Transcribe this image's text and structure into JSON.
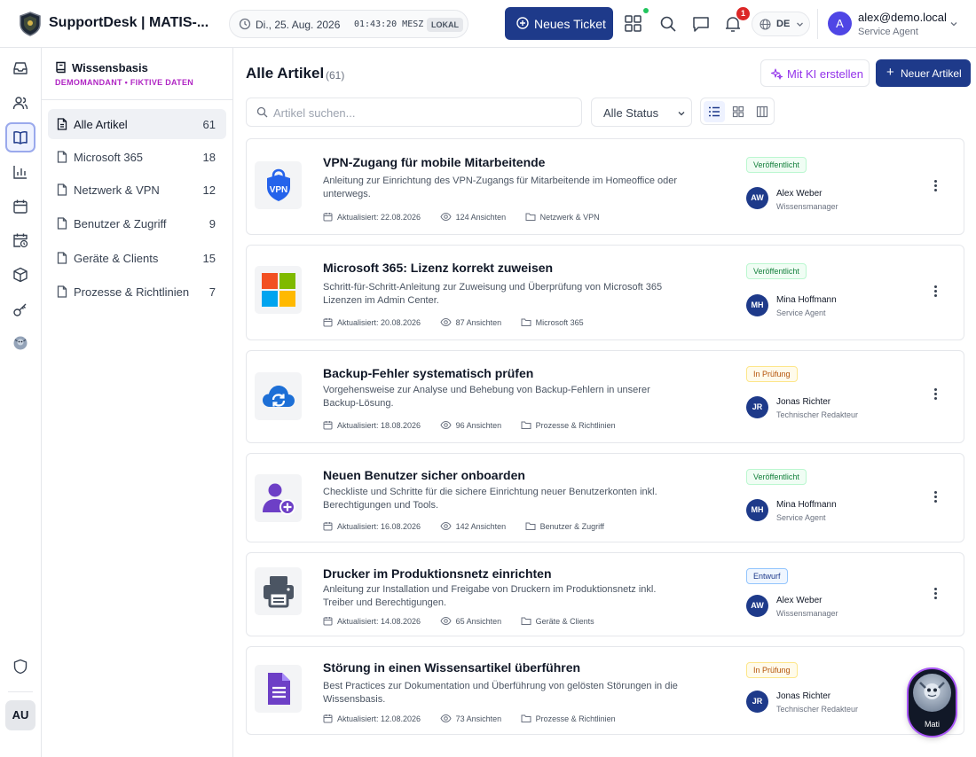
{
  "header": {
    "app_title": "SupportDesk | MATIS-...",
    "date": "Di., 25. Aug. 2026",
    "time": "01:43:20 MESZ",
    "time_badge": "LOKAL",
    "new_ticket_label": "Neues Ticket",
    "notification_count": "1",
    "language": "DE",
    "user_initial": "A",
    "user_email": "alex@demo.local",
    "user_role": "Service Agent"
  },
  "rail": {
    "user_initials": "AU"
  },
  "sidebar": {
    "title": "Wissensbasis",
    "subtitle": "DEMOMANDANT • FIKTIVE DATEN",
    "items": [
      {
        "label": "Alle Artikel",
        "count": "61",
        "active": true
      },
      {
        "label": "Microsoft 365",
        "count": "18"
      },
      {
        "label": "Netzwerk & VPN",
        "count": "12"
      },
      {
        "label": "Benutzer & Zugriff",
        "count": "9"
      },
      {
        "label": "Geräte & Clients",
        "count": "15"
      },
      {
        "label": "Prozesse & Richtlinien",
        "count": "7"
      }
    ]
  },
  "main": {
    "title": "Alle Artikel",
    "count": "(61)",
    "ai_button": "Mit KI erstellen",
    "new_article_button": "Neuer Artikel",
    "search_placeholder": "Artikel suchen...",
    "status_filter": "Alle Status"
  },
  "articles": [
    {
      "icon": "vpn-shield-icon",
      "title": "VPN-Zugang für mobile Mitarbeitende",
      "description": "Anleitung zur Einrichtung des VPN-Zugangs für Mitarbeitende im Homeoffice oder unterwegs.",
      "updated": "Aktualisiert: 22.08.2026",
      "views": "124 Ansichten",
      "category": "Netzwerk & VPN",
      "status": "Veröffentlicht",
      "author_initials": "AW",
      "author": "Alex Weber",
      "author_role": "Wissensmanager"
    },
    {
      "icon": "microsoft-logo-icon",
      "title": "Microsoft 365: Lizenz korrekt zuweisen",
      "description": "Schritt-für-Schritt-Anleitung zur Zuweisung und Überprüfung von Microsoft 365 Lizenzen im Admin Center.",
      "updated": "Aktualisiert: 20.08.2026",
      "views": "87 Ansichten",
      "category": "Microsoft 365",
      "status": "Veröffentlicht",
      "author_initials": "MH",
      "author": "Mina Hoffmann",
      "author_role": "Service Agent"
    },
    {
      "icon": "cloud-sync-icon",
      "title": "Backup-Fehler systematisch prüfen",
      "description": "Vorgehensweise zur Analyse und Behebung von Backup-Fehlern in unserer Backup-Lösung.",
      "updated": "Aktualisiert: 18.08.2026",
      "views": "96 Ansichten",
      "category": "Prozesse & Richtlinien",
      "status": "In Prüfung",
      "author_initials": "JR",
      "author": "Jonas Richter",
      "author_role": "Technischer Redakteur"
    },
    {
      "icon": "user-add-icon",
      "title": "Neuen Benutzer sicher onboarden",
      "description": "Checkliste und Schritte für die sichere Einrichtung neuer Benutzerkonten inkl. Berechtigungen und Tools.",
      "updated": "Aktualisiert: 16.08.2026",
      "views": "142 Ansichten",
      "category": "Benutzer & Zugriff",
      "status": "Veröffentlicht",
      "author_initials": "MH",
      "author": "Mina Hoffmann",
      "author_role": "Service Agent"
    },
    {
      "icon": "printer-icon",
      "title": "Drucker im Produktionsnetz einrichten",
      "description": "Anleitung zur Installation und Freigabe von Druckern im Produktionsnetz inkl. Treiber und Berechtigungen.",
      "updated": "Aktualisiert: 14.08.2026",
      "views": "65 Ansichten",
      "category": "Geräte & Clients",
      "status": "Entwurf",
      "author_initials": "AW",
      "author": "Alex Weber",
      "author_role": "Wissensmanager"
    },
    {
      "icon": "document-icon",
      "title": "Störung in einen Wissensartikel überführen",
      "description": "Best Practices zur Dokumentation und Überführung von gelösten Störungen in die Wissensbasis.",
      "updated": "Aktualisiert: 12.08.2026",
      "views": "73 Ansichten",
      "category": "Prozesse & Richtlinien",
      "status": "In Prüfung",
      "author_initials": "JR",
      "author": "Jonas Richter",
      "author_role": "Technischer Redakteur"
    }
  ],
  "assistant": {
    "label": "Mati"
  },
  "colors": {
    "primary": "#1e3a8a",
    "accent_purple": "#9333ea",
    "published": "#15803d",
    "review": "#b45309",
    "notification": "#dc2626"
  }
}
